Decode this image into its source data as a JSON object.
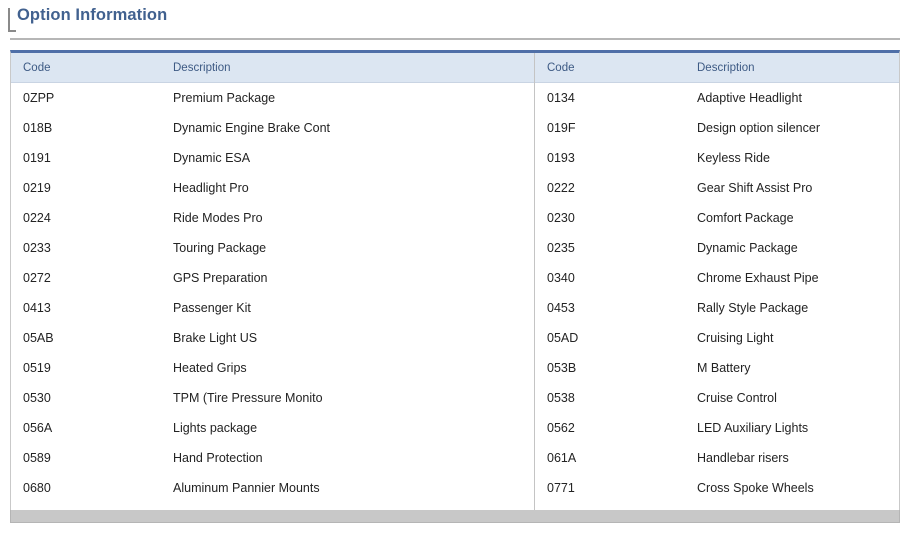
{
  "panel": {
    "title": "Option Information"
  },
  "table": {
    "headers": {
      "code": "Code",
      "description": "Description"
    },
    "left_rows": [
      {
        "code": "0ZPP",
        "description": "Premium Package"
      },
      {
        "code": "018B",
        "description": "Dynamic Engine Brake Cont"
      },
      {
        "code": "0191",
        "description": "Dynamic ESA"
      },
      {
        "code": "0219",
        "description": "Headlight Pro"
      },
      {
        "code": "0224",
        "description": "Ride Modes Pro"
      },
      {
        "code": "0233",
        "description": "Touring Package"
      },
      {
        "code": "0272",
        "description": "GPS Preparation"
      },
      {
        "code": "0413",
        "description": "Passenger Kit"
      },
      {
        "code": "05AB",
        "description": "Brake Light US"
      },
      {
        "code": "0519",
        "description": "Heated Grips"
      },
      {
        "code": "0530",
        "description": "TPM (Tire Pressure Monito"
      },
      {
        "code": "056A",
        "description": "Lights package"
      },
      {
        "code": "0589",
        "description": "Hand Protection"
      },
      {
        "code": "0680",
        "description": "Aluminum Pannier Mounts"
      }
    ],
    "right_rows": [
      {
        "code": "0134",
        "description": "Adaptive Headlight"
      },
      {
        "code": "019F",
        "description": "Design option silencer"
      },
      {
        "code": "0193",
        "description": "Keyless Ride"
      },
      {
        "code": "0222",
        "description": "Gear Shift Assist Pro"
      },
      {
        "code": "0230",
        "description": "Comfort Package"
      },
      {
        "code": "0235",
        "description": "Dynamic Package"
      },
      {
        "code": "0340",
        "description": "Chrome Exhaust Pipe"
      },
      {
        "code": "0453",
        "description": "Rally Style Package"
      },
      {
        "code": "05AD",
        "description": "Cruising Light"
      },
      {
        "code": "053B",
        "description": "M Battery"
      },
      {
        "code": "0538",
        "description": "Cruise Control"
      },
      {
        "code": "0562",
        "description": "LED Auxiliary Lights"
      },
      {
        "code": "061A",
        "description": "Handlebar risers"
      },
      {
        "code": "0771",
        "description": "Cross Spoke Wheels"
      }
    ]
  },
  "colors": {
    "title_text": "#41618f",
    "header_bg": "#dce6f2",
    "header_text": "#3d5a84",
    "table_top_border": "#4f6fa8",
    "footer_bar": "#c8c8c8"
  }
}
